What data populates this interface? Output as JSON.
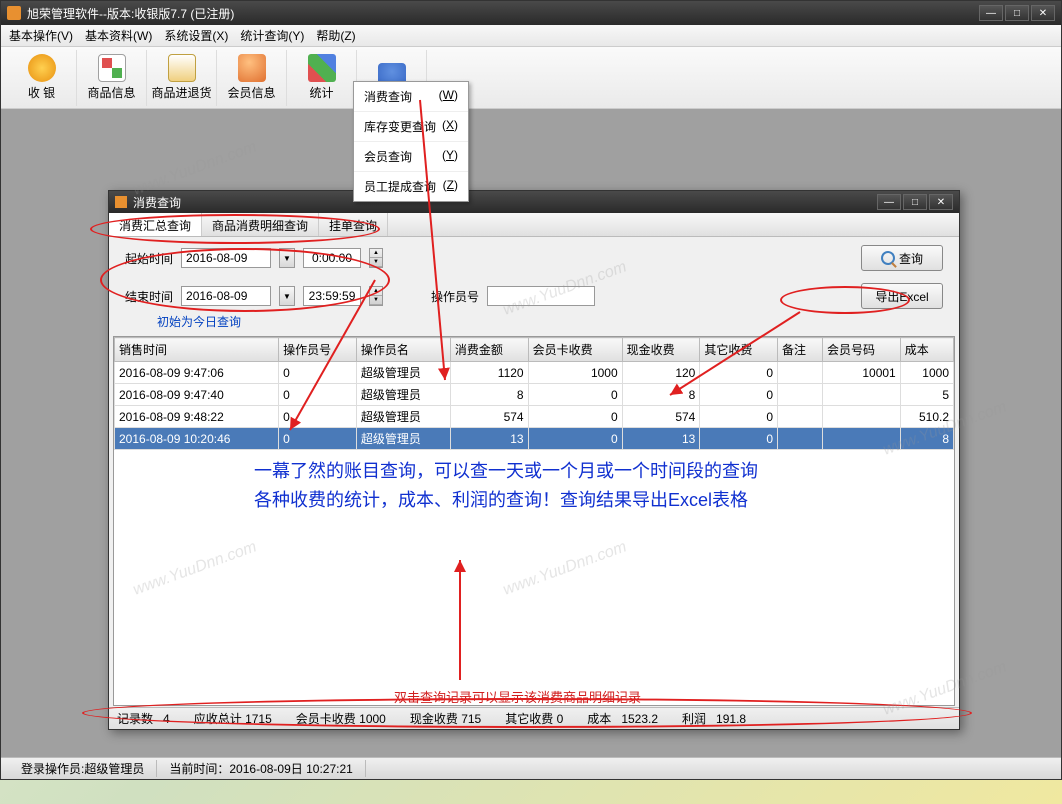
{
  "main_window": {
    "title": "旭荣管理软件--版本:收银版7.7 (已注册)"
  },
  "menubar": {
    "items": [
      "基本操作(V)",
      "基本资料(W)",
      "系统设置(X)",
      "统计查询(Y)",
      "帮助(Z)"
    ]
  },
  "toolbar": {
    "items": [
      "收 银",
      "商品信息",
      "商品进退货",
      "会员信息",
      "统计",
      ""
    ]
  },
  "dropdown": {
    "items": [
      {
        "label": "消费查询",
        "key": "(W)"
      },
      {
        "label": "库存变更查询",
        "key": "(X)"
      },
      {
        "label": "会员查询",
        "key": "(Y)"
      },
      {
        "label": "员工提成查询",
        "key": "(Z)"
      }
    ]
  },
  "sub_window": {
    "title": "消费查询",
    "tabs": [
      "消费汇总查询",
      "商品消费明细查询",
      "挂单查询"
    ],
    "filters": {
      "start_label": "起始时间",
      "start_date": "2016-08-09",
      "start_time": "0:00:00",
      "end_label": "结束时间",
      "end_date": "2016-08-09",
      "end_time": "23:59:59",
      "operator_label": "操作员号",
      "hint": "初始为今日查询",
      "query_btn": "查询",
      "export_btn": "导出Excel"
    },
    "table": {
      "headers": [
        "销售时间",
        "操作员号",
        "操作员名",
        "消费金额",
        "会员卡收费",
        "现金收费",
        "其它收费",
        "备注",
        "会员号码",
        "成本"
      ],
      "rows": [
        {
          "time": "2016-08-09 9:47:06",
          "opno": "0",
          "opname": "超级管理员",
          "amt": "1120",
          "card": "1000",
          "cash": "120",
          "other": "0",
          "remark": "",
          "mem": "10001",
          "cost": "1000"
        },
        {
          "time": "2016-08-09 9:47:40",
          "opno": "0",
          "opname": "超级管理员",
          "amt": "8",
          "card": "0",
          "cash": "8",
          "other": "0",
          "remark": "",
          "mem": "",
          "cost": "5"
        },
        {
          "time": "2016-08-09 9:48:22",
          "opno": "0",
          "opname": "超级管理员",
          "amt": "574",
          "card": "0",
          "cash": "574",
          "other": "0",
          "remark": "",
          "mem": "",
          "cost": "510.2"
        },
        {
          "time": "2016-08-09 10:20:46",
          "opno": "0",
          "opname": "超级管理员",
          "amt": "13",
          "card": "0",
          "cash": "13",
          "other": "0",
          "remark": "",
          "mem": "",
          "cost": "8"
        }
      ]
    },
    "annotation1_line1": "一幕了然的账目查询，可以查一天或一个月或一个时间段的查询",
    "annotation1_line2": "各种收费的统计，成本、利润的查询！查询结果导出Excel表格",
    "annotation2": "双击查询记录可以显示该消费商品明细记录",
    "summary": {
      "count_label": "记录数",
      "count": "4",
      "total_label": "应收总计",
      "total": "1715",
      "card_label": "会员卡收费",
      "card": "1000",
      "cash_label": "现金收费",
      "cash": "715",
      "other_label": "其它收费",
      "other": "0",
      "cost_label": "成本",
      "cost": "1523.2",
      "profit_label": "利润",
      "profit": "191.8"
    }
  },
  "status": {
    "operator_label": "登录操作员:",
    "operator": "超级管理员",
    "time_label": "当前时间：",
    "time": "2016-08-09日 10:27:21"
  },
  "watermark": "www.YuuDnn.com"
}
